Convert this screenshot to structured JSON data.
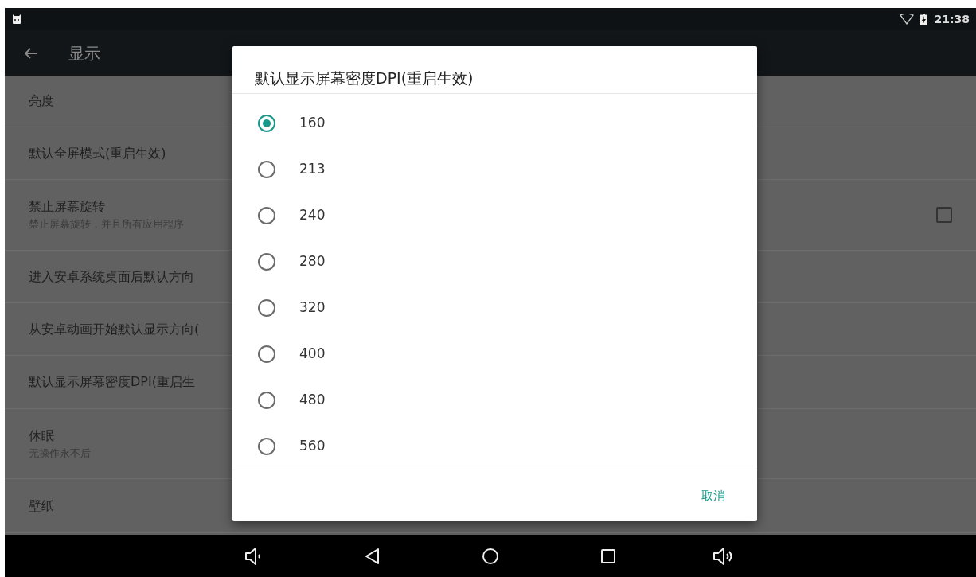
{
  "status_bar": {
    "time": "21:38"
  },
  "toolbar": {
    "title": "显示"
  },
  "settings": [
    {
      "title": "亮度"
    },
    {
      "title": "默认全屏模式(重启生效)"
    },
    {
      "title": "禁止屏幕旋转",
      "summary": "禁止屏幕旋转，并且所有应用程序",
      "checked": false
    },
    {
      "title": "进入安卓系统桌面后默认方向"
    },
    {
      "title": "从安卓动画开始默认显示方向("
    },
    {
      "title": "默认显示屏幕密度DPI(重启生"
    },
    {
      "title": "休眠",
      "summary": "无操作永不后"
    },
    {
      "title": "壁纸"
    }
  ],
  "dialog": {
    "title": "默认显示屏幕密度DPI(重启生效)",
    "options": [
      {
        "label": "160",
        "selected": true
      },
      {
        "label": "213",
        "selected": false
      },
      {
        "label": "240",
        "selected": false
      },
      {
        "label": "280",
        "selected": false
      },
      {
        "label": "320",
        "selected": false
      },
      {
        "label": "400",
        "selected": false
      },
      {
        "label": "480",
        "selected": false
      },
      {
        "label": "560",
        "selected": false
      }
    ],
    "cancel": "取消"
  }
}
